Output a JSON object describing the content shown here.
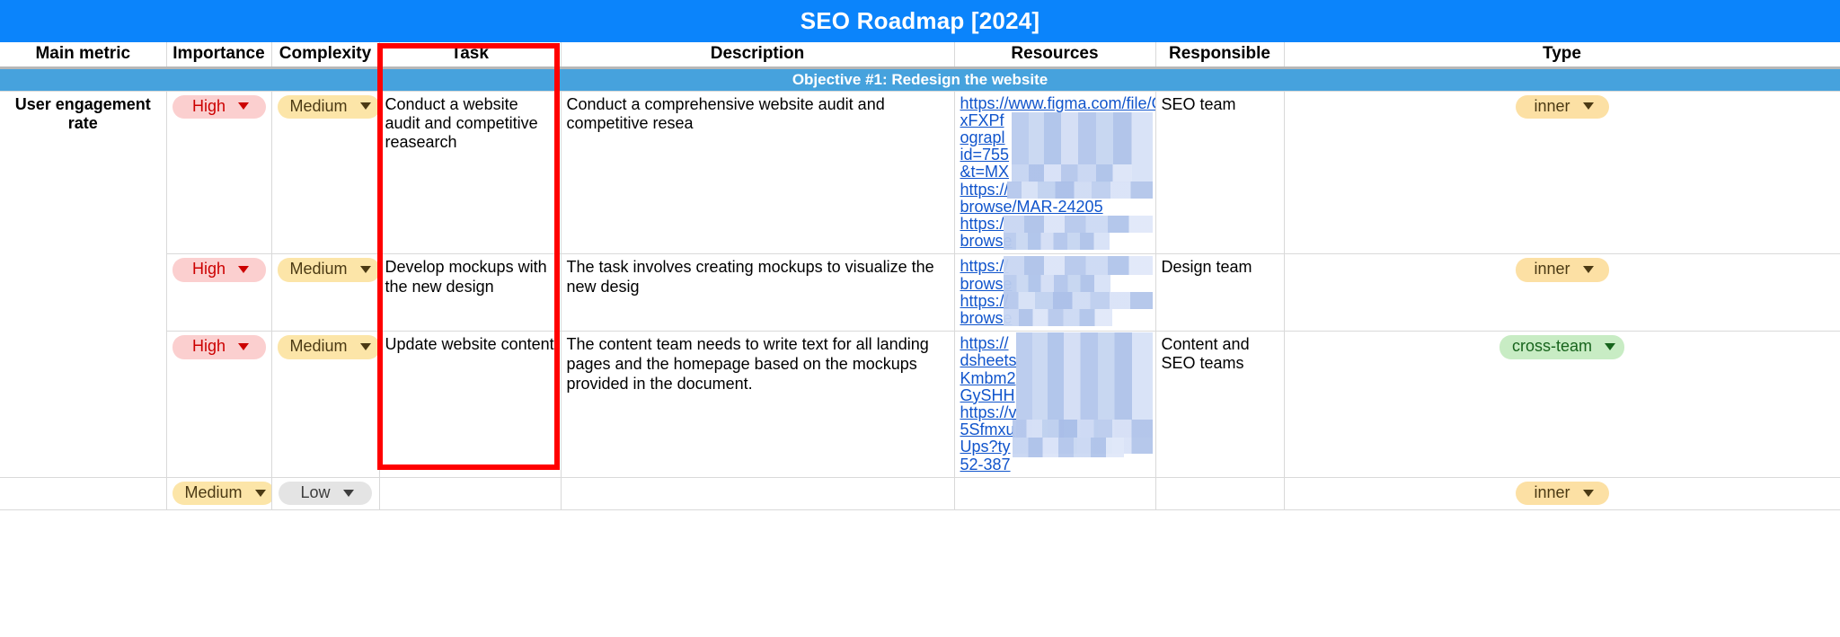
{
  "document": {
    "title": "SEO Roadmap [2024]"
  },
  "table": {
    "columns": [
      {
        "key": "main_metric",
        "label": "Main metric"
      },
      {
        "key": "importance",
        "label": "Importance"
      },
      {
        "key": "complexity",
        "label": "Complexity"
      },
      {
        "key": "task",
        "label": "Task"
      },
      {
        "key": "description",
        "label": "Description"
      },
      {
        "key": "resources",
        "label": "Resources"
      },
      {
        "key": "responsible",
        "label": "Responsible"
      },
      {
        "key": "type",
        "label": "Type"
      }
    ],
    "objective_band": "Objective #1: Redesign the website",
    "metric_group_label": "User engagement rate",
    "rows": [
      {
        "importance": "High",
        "importance_style": "high",
        "complexity": "Medium",
        "complexity_style": "medium",
        "task": "Conduct a website audit and competitive reasearch",
        "description": "Conduct a comprehensive website audit and competitive resea",
        "resources": [
          "https://www.figma.com/file/OV",
          "xFXPf",
          "ograpl",
          "id=755",
          "&t=MX",
          "https://",
          "browse/MAR-24205",
          "https:/",
          "browse"
        ],
        "responsible": "SEO team",
        "type": "inner",
        "type_style": "inner"
      },
      {
        "importance": "High",
        "importance_style": "high",
        "complexity": "Medium",
        "complexity_style": "medium",
        "task": "Develop mockups with the new design",
        "description": "The task involves creating mockups to visualize the new desig",
        "resources": [
          "https://",
          "browse",
          "https://",
          "browse"
        ],
        "responsible": "Design team",
        "type": "inner",
        "type_style": "inner"
      },
      {
        "importance": "High",
        "importance_style": "high",
        "complexity": "Medium",
        "complexity_style": "medium",
        "task": "Update website content",
        "description": "The content team needs to write text for all landing pages and the homepage based on the mockups provided in the document.",
        "resources": [
          "https://",
          "dsheets",
          "Kmbm2",
          "GySHH",
          "https://v",
          "5Sfmxu",
          "Ups?ty",
          "52-387"
        ],
        "responsible": "Content and SEO teams",
        "type": "cross-team",
        "type_style": "cross"
      },
      {
        "importance": "Medium",
        "importance_style": "medium",
        "complexity": "Low",
        "complexity_style": "low",
        "task": "",
        "description": "",
        "resources": [],
        "responsible": "",
        "type": "inner",
        "type_style": "inner"
      }
    ]
  },
  "annotation": {
    "highlight_target": "Task",
    "highlight_color": "#ff0000"
  },
  "icons": {
    "dropdown_caret": "chevron-down-icon"
  }
}
